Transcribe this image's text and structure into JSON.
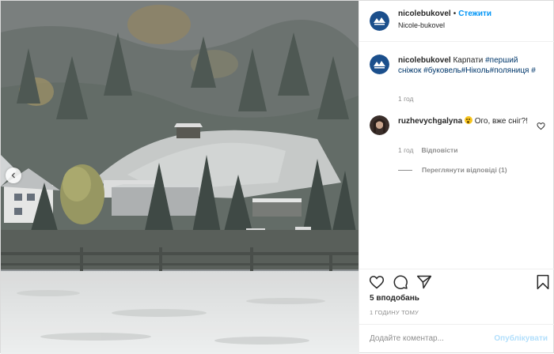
{
  "post": {
    "author": {
      "username": "nicolebukovel",
      "follow_label": "Стежити",
      "separator": "•",
      "location": "Nicole-bukovel",
      "avatar_color": "#1b4f8c"
    },
    "caption": {
      "username": "nicolebukovel",
      "text": "Карпати ",
      "hashtags": [
        "#перший",
        "сніжок",
        "#буковель",
        "#Ніколь",
        "#поляниця",
        "#"
      ],
      "time": "1 год"
    },
    "comments": [
      {
        "username": "ruzhevychgalyna",
        "text": "Ого, вже сніг?!",
        "emoji": "surprised-face",
        "time": "1 год",
        "reply_label": "Відповісти"
      }
    ],
    "view_replies_label": "Переглянути відповіді (1)",
    "likes_label": "5 вподобань",
    "time_ago": "1 ГОДИНУ ТОМУ",
    "add_comment_placeholder": "Додайте коментар...",
    "publish_label": "Опублікувати",
    "accent_color": "#0095f6"
  },
  "icons": [
    "heart-icon",
    "comment-icon",
    "share-icon",
    "bookmark-icon",
    "carousel-prev-icon",
    "small-heart-icon"
  ]
}
